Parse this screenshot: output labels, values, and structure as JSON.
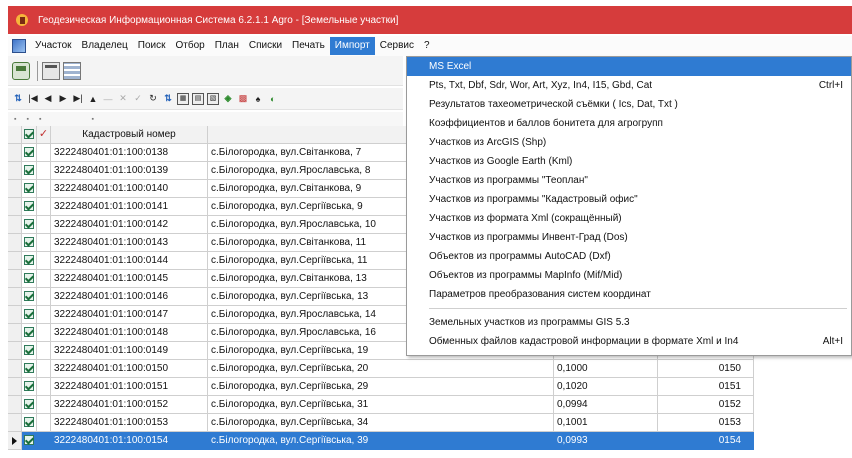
{
  "window": {
    "title": "Геодезическая Информационная Система 6.2.1.1 Agro - [Земельные участки]"
  },
  "menubar": {
    "items": [
      "Участок",
      "Владелец",
      "Поиск",
      "Отбор",
      "План",
      "Списки",
      "Печать",
      "Импорт",
      "Сервис",
      "?"
    ],
    "active": "Импорт"
  },
  "import_menu": {
    "items": [
      {
        "label": "MS Excel",
        "shortcut": "",
        "highlighted": true
      },
      {
        "label": "Pts, Txt, Dbf, Sdr, Wor, Art, Xyz, In4, I15, Gbd, Cat",
        "shortcut": "Ctrl+I"
      },
      {
        "label": "Результатов тахеометрической съёмки ( Ics, Dat, Txt )",
        "shortcut": ""
      },
      {
        "label": "Коэффициентов и баллов бонитета для агрогрупп",
        "shortcut": ""
      },
      {
        "label": "Участков из ArcGIS (Shp)",
        "shortcut": ""
      },
      {
        "label": "Участков из Google Earth (Kml)",
        "shortcut": ""
      },
      {
        "label": "Участков из программы \"Теоплан\"",
        "shortcut": ""
      },
      {
        "label": "Участков из программы \"Кадастровый офис\"",
        "shortcut": ""
      },
      {
        "label": "Участков из формата Xml (сокращённый)",
        "shortcut": ""
      },
      {
        "label": "Участков из программы Инвент-Град (Dos)",
        "shortcut": ""
      },
      {
        "label": "Объектов из программы AutoCAD (Dxf)",
        "shortcut": ""
      },
      {
        "label": "Объектов из программы MapInfo (Mif/Mid)",
        "shortcut": ""
      },
      {
        "label": "Параметров преобразования систем координат",
        "shortcut": ""
      }
    ],
    "items_after_separator": [
      {
        "label": "Земельных участков из программы GIS 5.3",
        "shortcut": ""
      },
      {
        "label": "Обменных файлов кадастровой информации в формате Xml и In4",
        "shortcut": "Alt+I"
      }
    ]
  },
  "grid": {
    "headers": {
      "checked": "",
      "flag": "✓",
      "cadastral": "Кадастровый номер",
      "address": "Адрес земельног"
    },
    "rows": [
      {
        "cadastral": "3222480401:01:100:0138",
        "address": "с.Білогородка, вул.Світанкова, 7",
        "area": "",
        "num": ""
      },
      {
        "cadastral": "3222480401:01:100:0139",
        "address": "с.Білогородка, вул.Ярославська, 8",
        "area": "",
        "num": ""
      },
      {
        "cadastral": "3222480401:01:100:0140",
        "address": "с.Білогородка, вул.Світанкова, 9",
        "area": "",
        "num": ""
      },
      {
        "cadastral": "3222480401:01:100:0141",
        "address": "с.Білогородка, вул.Сергіївська, 9",
        "area": "",
        "num": ""
      },
      {
        "cadastral": "3222480401:01:100:0142",
        "address": "с.Білогородка, вул.Ярославська, 10",
        "area": "",
        "num": ""
      },
      {
        "cadastral": "3222480401:01:100:0143",
        "address": "с.Білогородка, вул.Світанкова, 11",
        "area": "",
        "num": ""
      },
      {
        "cadastral": "3222480401:01:100:0144",
        "address": "с.Білогородка, вул.Сергіївська, 11",
        "area": "",
        "num": ""
      },
      {
        "cadastral": "3222480401:01:100:0145",
        "address": "с.Білогородка, вул.Світанкова, 13",
        "area": "",
        "num": ""
      },
      {
        "cadastral": "3222480401:01:100:0146",
        "address": "с.Білогородка, вул.Сергіївська, 13",
        "area": "",
        "num": ""
      },
      {
        "cadastral": "3222480401:01:100:0147",
        "address": "с.Білогородка, вул.Ярославська, 14",
        "area": "",
        "num": ""
      },
      {
        "cadastral": "3222480401:01:100:0148",
        "address": "с.Білогородка, вул.Ярославська, 16",
        "area": "",
        "num": ""
      },
      {
        "cadastral": "3222480401:01:100:0149",
        "address": "с.Білогородка, вул.Сергіївська, 19",
        "area": "0,1022",
        "num": "0149"
      },
      {
        "cadastral": "3222480401:01:100:0150",
        "address": "с.Білогородка, вул.Сергіївська, 20",
        "area": "0,1000",
        "num": "0150"
      },
      {
        "cadastral": "3222480401:01:100:0151",
        "address": "с.Білогородка, вул.Сергіївська, 29",
        "area": "0,1020",
        "num": "0151"
      },
      {
        "cadastral": "3222480401:01:100:0152",
        "address": "с.Білогородка, вул.Сергіївська, 31",
        "area": "0,0994",
        "num": "0152"
      },
      {
        "cadastral": "3222480401:01:100:0153",
        "address": "с.Білогородка, вул.Сергіївська, 34",
        "area": "0,1001",
        "num": "0153"
      },
      {
        "cadastral": "3222480401:01:100:0154",
        "address": "с.Білогородка, вул.Сергіївська, 39",
        "area": "0,0993",
        "num": "0154",
        "selected": true
      }
    ]
  },
  "colors": {
    "title_bar": "#d63c3c",
    "selection": "#2f7bd2"
  },
  "icons": {
    "title": "app-logo-icon",
    "menu": "app-menu-icon",
    "toolbar": [
      "save-icon",
      "window-icon",
      "grid-icon"
    ]
  }
}
